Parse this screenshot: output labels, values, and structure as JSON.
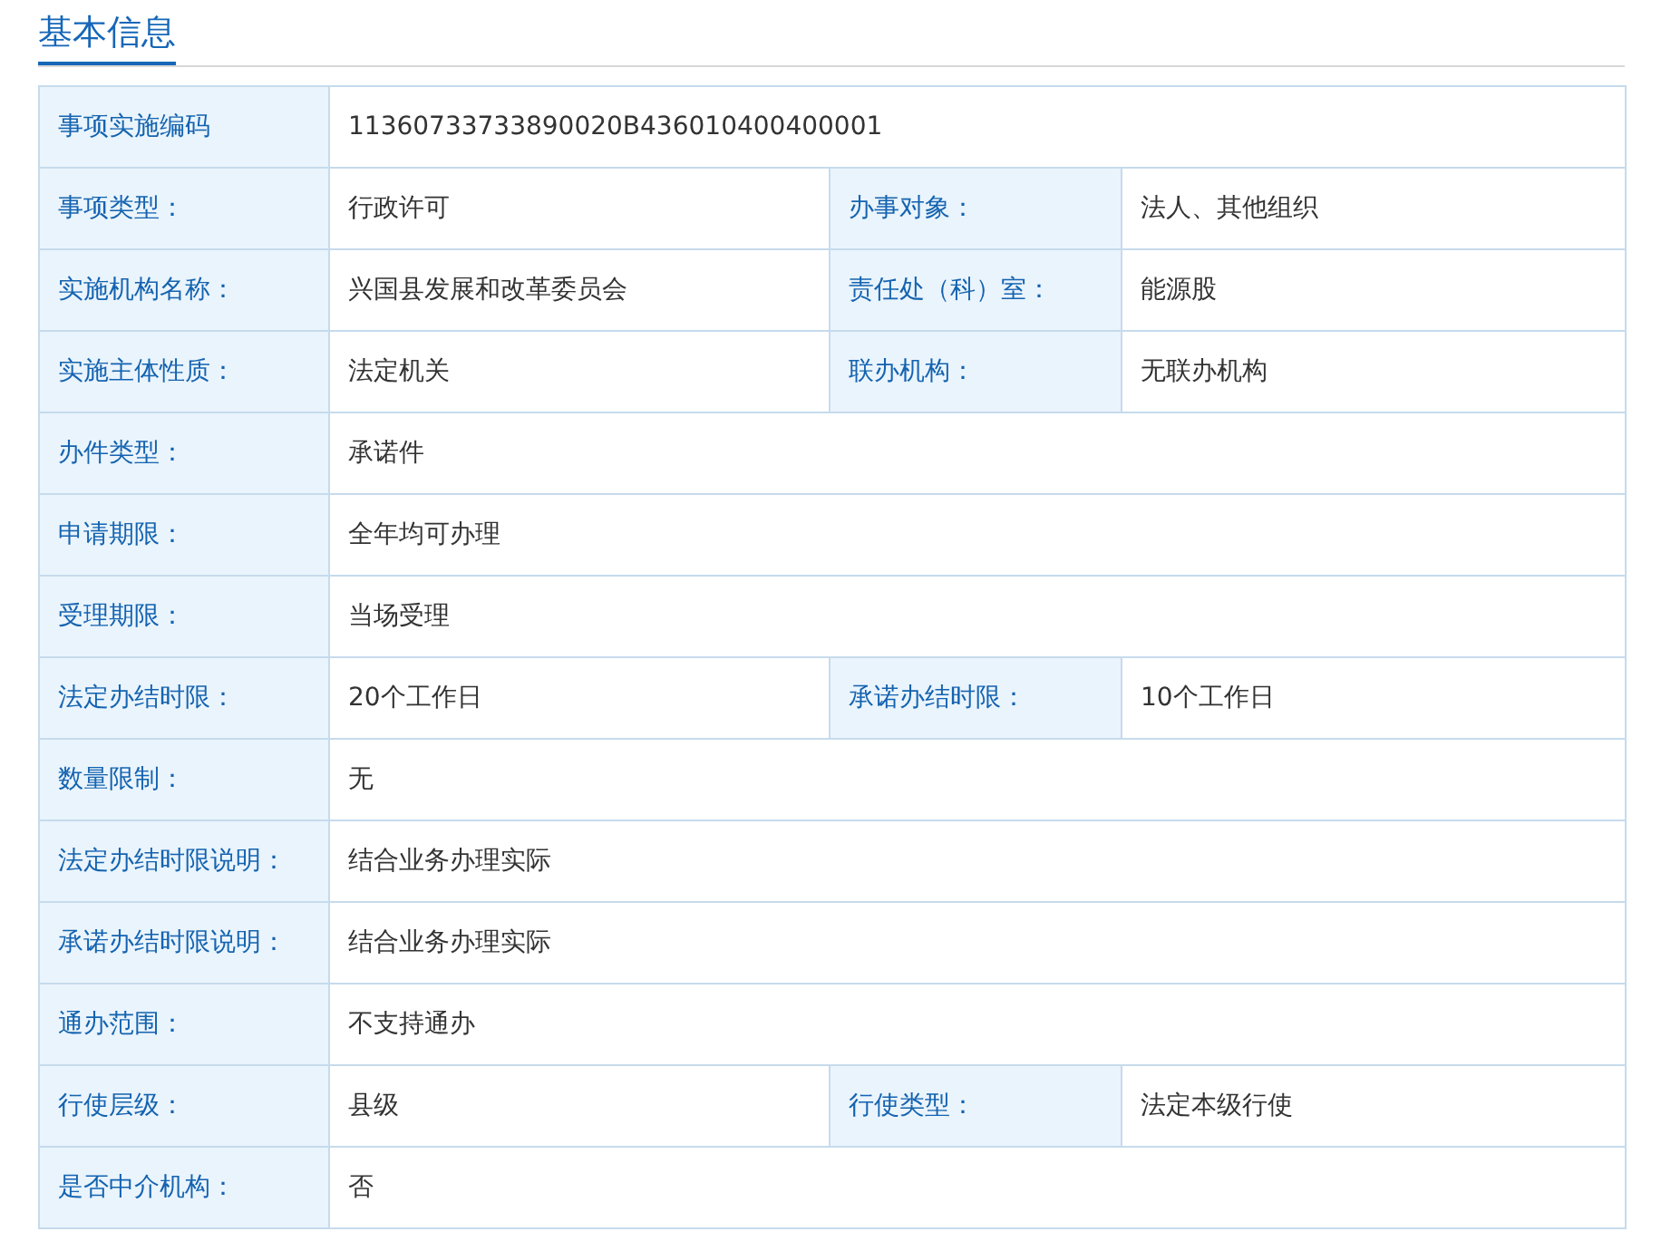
{
  "section": {
    "title": "基本信息"
  },
  "rows": [
    {
      "pairs": [
        {
          "label": "事项实施编码",
          "value": "11360733733890020B436010400400001"
        }
      ]
    },
    {
      "pairs": [
        {
          "label": "事项类型：",
          "value": "行政许可"
        },
        {
          "label": "办事对象：",
          "value": "法人、其他组织"
        }
      ]
    },
    {
      "pairs": [
        {
          "label": "实施机构名称：",
          "value": "兴国县发展和改革委员会"
        },
        {
          "label": "责任处（科）室：",
          "value": "能源股"
        }
      ]
    },
    {
      "pairs": [
        {
          "label": "实施主体性质：",
          "value": "法定机关"
        },
        {
          "label": "联办机构：",
          "value": "无联办机构"
        }
      ]
    },
    {
      "pairs": [
        {
          "label": "办件类型：",
          "value": "承诺件"
        }
      ]
    },
    {
      "pairs": [
        {
          "label": "申请期限：",
          "value": "全年均可办理"
        }
      ]
    },
    {
      "pairs": [
        {
          "label": "受理期限：",
          "value": "当场受理"
        }
      ]
    },
    {
      "pairs": [
        {
          "label": "法定办结时限：",
          "value": "20个工作日"
        },
        {
          "label": "承诺办结时限：",
          "value": "10个工作日"
        }
      ]
    },
    {
      "pairs": [
        {
          "label": "数量限制：",
          "value": "无"
        }
      ]
    },
    {
      "pairs": [
        {
          "label": "法定办结时限说明：",
          "value": "结合业务办理实际"
        }
      ]
    },
    {
      "pairs": [
        {
          "label": "承诺办结时限说明：",
          "value": "结合业务办理实际"
        }
      ]
    },
    {
      "pairs": [
        {
          "label": "通办范围：",
          "value": "不支持通办"
        }
      ]
    },
    {
      "pairs": [
        {
          "label": "行使层级：",
          "value": "县级"
        },
        {
          "label": "行使类型：",
          "value": "法定本级行使"
        }
      ]
    },
    {
      "pairs": [
        {
          "label": "是否中介机构：",
          "value": "否"
        }
      ]
    }
  ]
}
